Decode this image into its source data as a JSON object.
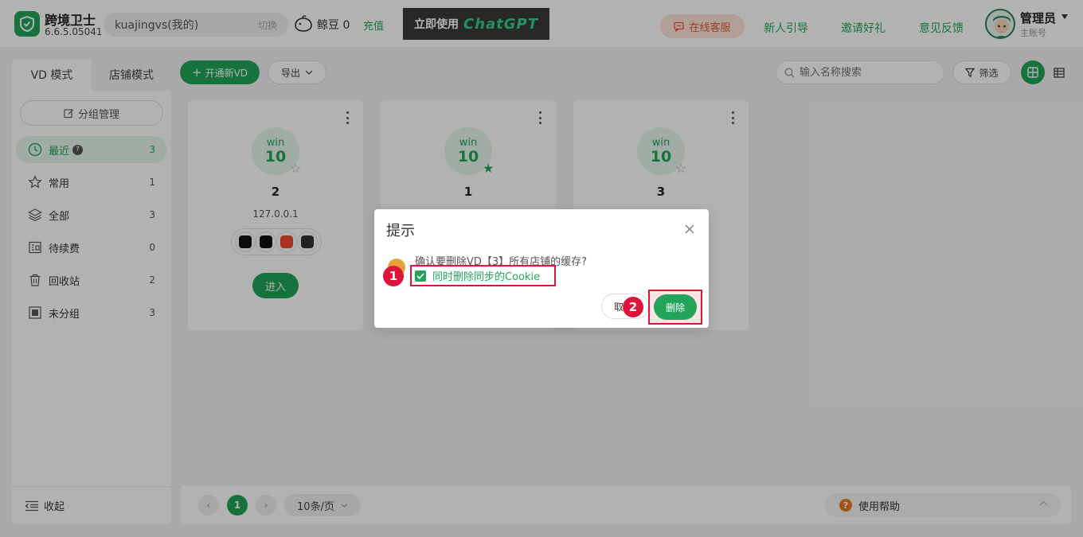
{
  "header": {
    "app_name": "跨境卫士",
    "version": "6.6.5.05041",
    "account_name": "kuajingvs(我的)",
    "account_switch": "切换",
    "beans_label": "鲸豆 0",
    "recharge": "充值",
    "banner_text": "立即使用",
    "banner_brand": "ChatGPT",
    "online_service": "在线客服",
    "nav": [
      "新人引导",
      "邀请好礼",
      "意见反馈"
    ],
    "user_name": "管理员",
    "user_role": "主账号"
  },
  "sidebar": {
    "tabs": [
      "VD 模式",
      "店铺模式"
    ],
    "group_manage": "分组管理",
    "items": [
      {
        "label": "最近",
        "count": "3",
        "icon": "clock-icon"
      },
      {
        "label": "常用",
        "count": "1",
        "icon": "star-icon"
      },
      {
        "label": "全部",
        "count": "3",
        "icon": "layers-icon"
      },
      {
        "label": "待续费",
        "count": "0",
        "icon": "renew-icon"
      },
      {
        "label": "回收站",
        "count": "2",
        "icon": "trash-icon"
      },
      {
        "label": "未分组",
        "count": "3",
        "icon": "ungrouped-icon"
      }
    ],
    "collapse": "收起"
  },
  "toolbar": {
    "new_vd": "开通新VD",
    "export": "导出",
    "search_placeholder": "输入名称搜索",
    "filter": "筛选"
  },
  "cards": [
    {
      "os": "win",
      "ver": "10",
      "title": "2",
      "ip": "127.0.0.1",
      "favorite": false,
      "enter": "进入"
    },
    {
      "os": "win",
      "ver": "10",
      "title": "1",
      "favorite": true
    },
    {
      "os": "win",
      "ver": "10",
      "title": "3",
      "favorite": false
    }
  ],
  "footer": {
    "page": "1",
    "page_size": "10条/页",
    "help": "使用帮助"
  },
  "dialog": {
    "title": "提示",
    "message": "确认要删除VD【3】所有店铺的缓存?",
    "checkbox_label": "同时删除同步的Cookie",
    "cancel": "取消",
    "confirm": "删除",
    "step1": "1",
    "step2": "2"
  },
  "colors": {
    "accent": "#22a55a",
    "highlight": "#e0143b"
  }
}
